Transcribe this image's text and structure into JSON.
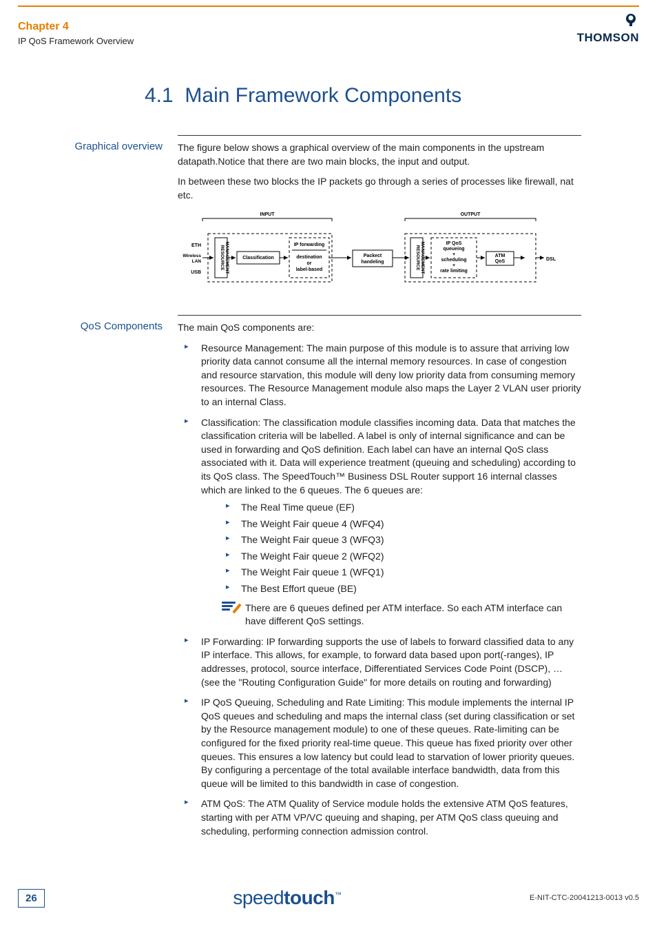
{
  "header": {
    "chapter": "Chapter 4",
    "subtitle": "IP QoS Framework Overview",
    "brand": "THOMSON"
  },
  "section": {
    "number": "4.1",
    "title": "Main Framework Components"
  },
  "graphical": {
    "label": "Graphical overview",
    "p1": "The figure below shows a graphical overview of the main components in the upstream datapath.Notice that there are two main blocks, the input and output.",
    "p2": "In between these two blocks the IP packets go through a series of processes like firewall, nat etc."
  },
  "diagram": {
    "input_label": "INPUT",
    "output_label": "OUTPUT",
    "left_if_eth": "ETH",
    "left_if_wlan": "Wireless LAN",
    "left_if_usb": "USB",
    "res_mgmt": "RESOURCE MANAGEMENT",
    "classification": "Classification",
    "ipfwd1": "IP forwarding",
    "ipfwd2": "destination or label-based",
    "packet": "Packect handeling",
    "ipqos1": "IP QoS queueing",
    "ipqos2": "+",
    "ipqos3": "scheduling",
    "ipqos4": "+",
    "ipqos5": "rate limiting",
    "atmqos": "ATM QoS",
    "dsl": "DSL"
  },
  "qos": {
    "label": "QoS Components",
    "intro": "The main QoS components are:",
    "item1": "Resource Management: The main purpose of this module is to assure that arriving low priority data cannot consume all the internal memory resources. In case of congestion and resource starvation, this module will deny low priority data from consuming memory resources. The Resource Management module also maps the Layer 2 VLAN user priority to an internal Class.",
    "item2": "Classification: The classification module classifies incoming data. Data that matches the classification criteria will be labelled. A label is only of internal significance and can be used in forwarding and QoS definition. Each label can have an internal QoS class associated with it. Data will experience treatment (queuing and scheduling) according to its QoS class. The SpeedTouch™ Business DSL Router support 16 internal classes which are linked to the 6 queues. The 6 queues are:",
    "sub1": "The Real Time queue (EF)",
    "sub2": "The Weight Fair queue 4 (WFQ4)",
    "sub3": "The Weight Fair queue 3 (WFQ3)",
    "sub4": "The Weight Fair queue 2 (WFQ2)",
    "sub5": "The Weight Fair queue 1 (WFQ1)",
    "sub6": "The Best Effort queue (BE)",
    "note": "There are 6 queues defined per ATM interface. So each ATM interface can have different QoS settings.",
    "item3": "IP Forwarding: IP forwarding supports the use of labels to forward classified data to any IP interface. This allows, for example, to forward data based upon port(-ranges), IP addresses, protocol, source interface, Differentiated Services Code Point (DSCP), … (see the \"Routing Configuration Guide\" for more details on routing and forwarding)",
    "item4": "IP QoS Queuing, Scheduling and Rate Limiting: This module implements the internal IP QoS queues and scheduling and maps the internal class (set during classification or set by the Resource management module) to one of these queues. Rate-limiting can be configured for the fixed priority real-time queue. This queue has fixed priority over other queues. This ensures a low latency but could lead to starvation of lower priority queues. By configuring a percentage of the total available interface bandwidth, data from this queue will be limited to this bandwidth in case of congestion.",
    "item5": "ATM QoS: The ATM Quality of Service module holds the extensive ATM QoS features, starting with per ATM VP/VC queuing and shaping, per ATM QoS class queuing and scheduling, performing connection admission control."
  },
  "footer": {
    "page": "26",
    "logo_light": "speed",
    "logo_bold": "touch",
    "tm": "™",
    "docref": "E-NIT-CTC-20041213-0013 v0.5"
  }
}
